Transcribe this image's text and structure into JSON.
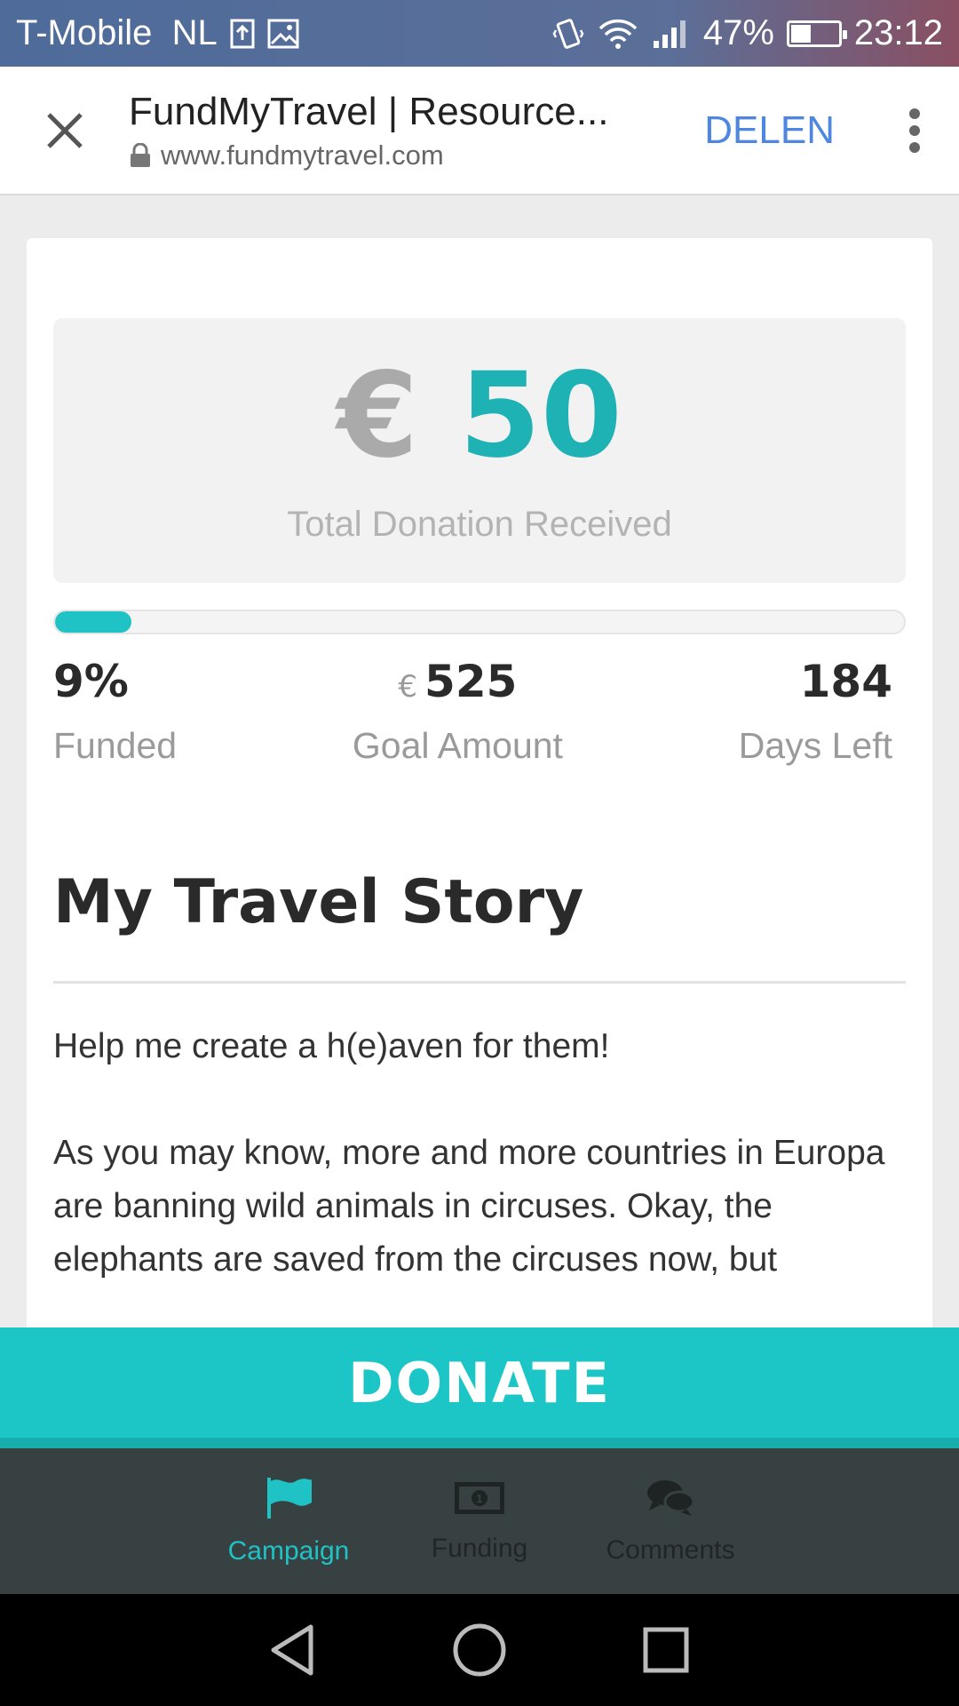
{
  "status_bar": {
    "carrier": "T-Mobile  NL",
    "battery_percent": "47%",
    "battery_level": 0.47,
    "time": "23:12",
    "icons": [
      "upload-notification-icon",
      "image-notification-icon",
      "vibrate-icon",
      "wifi-icon",
      "signal-icon",
      "battery-icon"
    ]
  },
  "browser": {
    "title": "FundMyTravel | Resource...",
    "url": "www.fundmytravel.com",
    "share_label": "DELEN",
    "icons": [
      "close-icon",
      "lock-icon",
      "more-vert-icon"
    ]
  },
  "donation": {
    "currency": "€",
    "amount": "50",
    "label": "Total Donation Received",
    "progress_fraction": 0.09
  },
  "stats": {
    "funded_value": "9%",
    "funded_label": "Funded",
    "goal_currency": "€",
    "goal_value": "525",
    "goal_label": "Goal Amount",
    "days_value": "184",
    "days_label": "Days Left"
  },
  "story": {
    "title": "My Travel Story",
    "paragraphs": [
      "Help me create a h(e)aven for them!",
      "As you may know, more and more countries in Europa are banning wild animals in circuses. Okay, the elephants are saved from the circuses now, but"
    ]
  },
  "donate_label": "DONATE",
  "tabs": [
    {
      "label": "Campaign",
      "icon": "flag-icon",
      "active": true
    },
    {
      "label": "Funding",
      "icon": "money-icon",
      "active": false
    },
    {
      "label": "Comments",
      "icon": "comments-icon",
      "active": false
    }
  ],
  "colors": {
    "accent": "#1fc3c6",
    "amount": "#1fb2b4",
    "share": "#4f86e0",
    "tab_bar": "#374141"
  }
}
